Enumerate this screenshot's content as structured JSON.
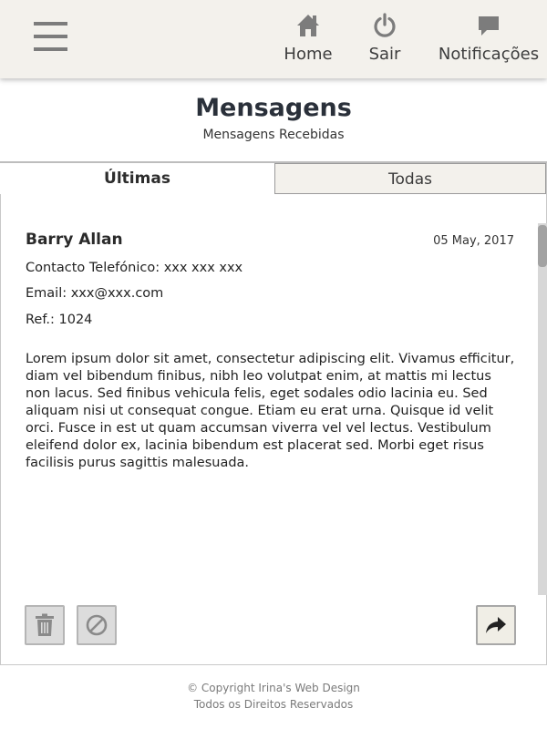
{
  "header": {
    "menu_icon": "hamburger-menu-icon",
    "nav": [
      {
        "label": "Home",
        "icon": "home-icon"
      },
      {
        "label": "Sair",
        "icon": "power-icon"
      },
      {
        "label": "Notificações",
        "icon": "chat-bubble-icon"
      }
    ]
  },
  "page": {
    "title": "Mensagens",
    "subtitle": "Mensagens Recebidas"
  },
  "tabs": [
    {
      "label": "Últimas",
      "active": true
    },
    {
      "label": "Todas",
      "active": false
    }
  ],
  "message": {
    "sender": "Barry Allan",
    "date": "05 May, 2017",
    "phone": "Contacto Telefónico: xxx xxx xxx",
    "email": "Email: xxx@xxx.com",
    "ref": "Ref.: 1024",
    "body": "Lorem ipsum dolor sit amet, consectetur adipiscing elit. Vivamus efficitur, diam vel bibendum finibus, nibh leo volutpat enim, at mattis mi lectus non lacus. Sed finibus vehicula felis, eget sodales odio lacinia eu. Sed aliquam nisi ut consequat congue. Etiam eu erat urna. Quisque id velit orci. Fusce in est ut quam accumsan viverra vel vel lectus. Vestibulum eleifend dolor ex, lacinia bibendum est placerat sed. Morbi eget risus facilisis purus sagittis malesuada."
  },
  "actions": {
    "delete_icon": "trash-icon",
    "block_icon": "block-icon",
    "reply_icon": "share-arrow-icon"
  },
  "footer": {
    "copyright": "© Copyright Irina's Web Design",
    "rights": "Todos os Direitos Reservados"
  },
  "colors": {
    "header_bg": "#f3f1ec",
    "title": "#2a303a",
    "icon_gray": "#7c7c7c"
  }
}
